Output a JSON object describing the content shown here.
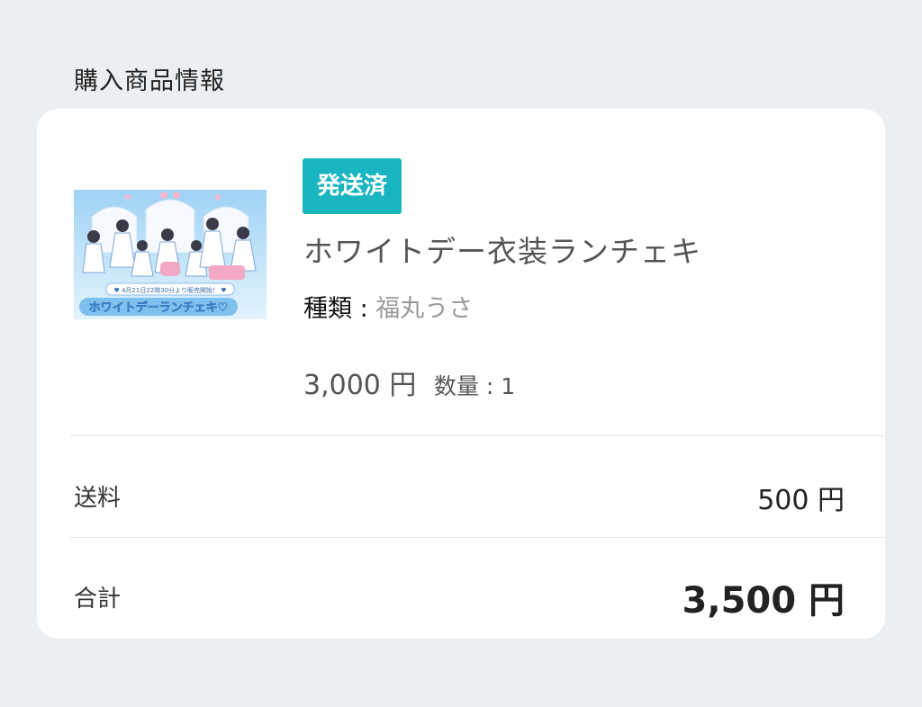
{
  "section_title": "購入商品情報",
  "item": {
    "status": "発送済",
    "name": "ホワイトデー衣装ランチェキ",
    "variant_label": "種類 :",
    "variant_value": "福丸うさ",
    "price": "3,000 円",
    "quantity_text": "数量 : 1",
    "thumbnail": {
      "banner_date_text": "♥ 4月21日22時30分より販売開始！ ♥",
      "banner_title": "ホワイトデーランチェキ♡"
    }
  },
  "shipping": {
    "label": "送料",
    "value": "500 円"
  },
  "total": {
    "label": "合計",
    "value": "3,500 円"
  },
  "colors": {
    "background": "#eceff1",
    "card": "#ffffff",
    "badge": "#19b6c1",
    "divider": "#e6e6e6"
  }
}
